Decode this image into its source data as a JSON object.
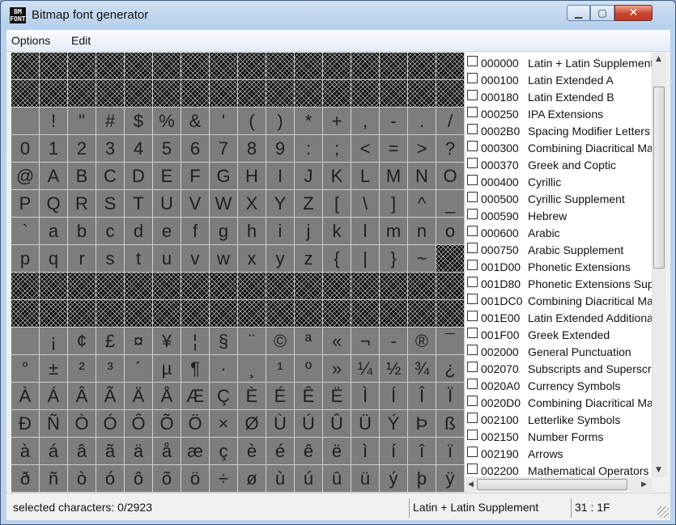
{
  "window": {
    "title": "Bitmap font generator",
    "icon_text": "BM\nFONT"
  },
  "menu": [
    "Options",
    "Edit"
  ],
  "char_grid": [
    [
      "",
      "",
      "",
      "",
      "",
      "",
      "",
      "",
      "",
      "",
      "",
      "",
      "",
      "",
      "",
      ""
    ],
    [
      "",
      "",
      "",
      "",
      "",
      "",
      "",
      "",
      "",
      "",
      "",
      "",
      "",
      "",
      "",
      ""
    ],
    [
      " ",
      "!",
      "\"",
      "#",
      "$",
      "%",
      "&",
      "'",
      "(",
      ")",
      "*",
      "+",
      ",",
      "-",
      ".",
      "/"
    ],
    [
      "0",
      "1",
      "2",
      "3",
      "4",
      "5",
      "6",
      "7",
      "8",
      "9",
      ":",
      ";",
      "<",
      "=",
      ">",
      "?"
    ],
    [
      "@",
      "A",
      "B",
      "C",
      "D",
      "E",
      "F",
      "G",
      "H",
      "I",
      "J",
      "K",
      "L",
      "M",
      "N",
      "O"
    ],
    [
      "P",
      "Q",
      "R",
      "S",
      "T",
      "U",
      "V",
      "W",
      "X",
      "Y",
      "Z",
      "[",
      "\\",
      "]",
      "^",
      "_"
    ],
    [
      "`",
      "a",
      "b",
      "c",
      "d",
      "e",
      "f",
      "g",
      "h",
      "i",
      "j",
      "k",
      "l",
      "m",
      "n",
      "o"
    ],
    [
      "p",
      "q",
      "r",
      "s",
      "t",
      "u",
      "v",
      "w",
      "x",
      "y",
      "z",
      "{",
      "|",
      "}",
      "~",
      ""
    ],
    [
      "",
      "",
      "",
      "",
      "",
      "",
      "",
      "",
      "",
      "",
      "",
      "",
      "",
      "",
      "",
      ""
    ],
    [
      "",
      "",
      "",
      "",
      "",
      "",
      "",
      "",
      "",
      "",
      "",
      "",
      "",
      "",
      "",
      ""
    ],
    [
      " ",
      "¡",
      "¢",
      "£",
      "¤",
      "¥",
      "¦",
      "§",
      "¨",
      "©",
      "ª",
      "«",
      "¬",
      "-",
      "®",
      "¯"
    ],
    [
      "°",
      "±",
      "²",
      "³",
      "´",
      "µ",
      "¶",
      "·",
      "¸",
      "¹",
      "º",
      "»",
      "¼",
      "½",
      "¾",
      "¿"
    ],
    [
      "À",
      "Á",
      "Â",
      "Ã",
      "Ä",
      "Å",
      "Æ",
      "Ç",
      "È",
      "É",
      "Ê",
      "Ë",
      "Ì",
      "Í",
      "Î",
      "Ï"
    ],
    [
      "Ð",
      "Ñ",
      "Ò",
      "Ó",
      "Ô",
      "Õ",
      "Ö",
      "×",
      "Ø",
      "Ù",
      "Ú",
      "Û",
      "Ü",
      "Ý",
      "Þ",
      "ß"
    ],
    [
      "à",
      "á",
      "â",
      "ã",
      "ä",
      "å",
      "æ",
      "ç",
      "è",
      "é",
      "ê",
      "ë",
      "ì",
      "í",
      "î",
      "ï"
    ],
    [
      "ð",
      "ñ",
      "ò",
      "ó",
      "ô",
      "õ",
      "ö",
      "÷",
      "ø",
      "ù",
      "ú",
      "û",
      "ü",
      "ý",
      "þ",
      "ÿ"
    ]
  ],
  "unavailable_cells": [
    [
      0,
      "all"
    ],
    [
      1,
      "all"
    ],
    [
      7,
      15
    ],
    [
      8,
      "all"
    ],
    [
      9,
      "all"
    ]
  ],
  "charset_list": [
    {
      "code": "000000",
      "name": "Latin + Latin Supplement"
    },
    {
      "code": "000100",
      "name": "Latin Extended A"
    },
    {
      "code": "000180",
      "name": "Latin Extended B"
    },
    {
      "code": "000250",
      "name": "IPA Extensions"
    },
    {
      "code": "0002B0",
      "name": "Spacing Modifier Letters"
    },
    {
      "code": "000300",
      "name": "Combining Diacritical Marks"
    },
    {
      "code": "000370",
      "name": "Greek and Coptic"
    },
    {
      "code": "000400",
      "name": "Cyrillic"
    },
    {
      "code": "000500",
      "name": "Cyrillic Supplement"
    },
    {
      "code": "000590",
      "name": "Hebrew"
    },
    {
      "code": "000600",
      "name": "Arabic"
    },
    {
      "code": "000750",
      "name": "Arabic Supplement"
    },
    {
      "code": "001D00",
      "name": "Phonetic Extensions"
    },
    {
      "code": "001D80",
      "name": "Phonetic Extensions Supplement"
    },
    {
      "code": "001DC0",
      "name": "Combining Diacritical Marks Supplement"
    },
    {
      "code": "001E00",
      "name": "Latin Extended Additional"
    },
    {
      "code": "001F00",
      "name": "Greek Extended"
    },
    {
      "code": "002000",
      "name": "General Punctuation"
    },
    {
      "code": "002070",
      "name": "Subscripts and Superscripts"
    },
    {
      "code": "0020A0",
      "name": "Currency Symbols"
    },
    {
      "code": "0020D0",
      "name": "Combining Diacritical Marks for Symbols"
    },
    {
      "code": "002100",
      "name": "Letterlike Symbols"
    },
    {
      "code": "002150",
      "name": "Number Forms"
    },
    {
      "code": "002190",
      "name": "Arrows"
    },
    {
      "code": "002200",
      "name": "Mathematical Operators"
    }
  ],
  "status": {
    "selected": "selected characters: 0/2923",
    "charset": "Latin + Latin Supplement",
    "cursor": "31 : 1F"
  },
  "colors": {
    "grid_available": "#7d7d7d",
    "grid_unavailable": "#000000",
    "close_button": "#c8442f"
  }
}
